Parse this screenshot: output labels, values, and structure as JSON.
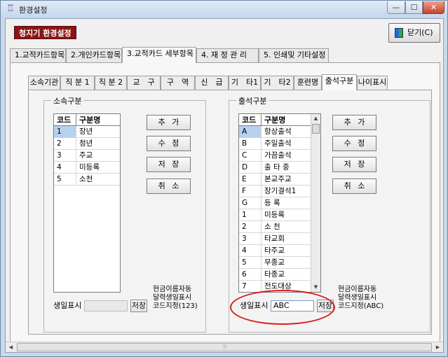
{
  "window": {
    "title": "환경설정",
    "minimize": "—",
    "maximize": "☐",
    "close": "✕",
    "app_icon": "chair-icon"
  },
  "header": {
    "label": "청지기 환경설정",
    "close_button": "닫기(C)"
  },
  "main_tabs": [
    {
      "label": "1.교적카드항목"
    },
    {
      "label": "2.개인카드항목"
    },
    {
      "label": "3.교적카드 세부항목",
      "active": true
    },
    {
      "label": "4. 재 정 관 리"
    },
    {
      "label": "5. 인쇄및 기타설정"
    }
  ],
  "sub_tabs": [
    {
      "label": "소속기관"
    },
    {
      "label": "직 분 1"
    },
    {
      "label": "직 분 2"
    },
    {
      "label": "교　구"
    },
    {
      "label": "구　역"
    },
    {
      "label": "신　급"
    },
    {
      "label": "기　타1"
    },
    {
      "label": "기　타2"
    },
    {
      "label": "훈련명"
    },
    {
      "label": "출석구분",
      "active": true
    },
    {
      "label": "나이표시"
    }
  ],
  "left_group": {
    "title": "소속구분",
    "columns": [
      "코드",
      "구분명"
    ],
    "rows": [
      {
        "code": "1",
        "name": "장년"
      },
      {
        "code": "2",
        "name": "청년"
      },
      {
        "code": "3",
        "name": "주교"
      },
      {
        "code": "4",
        "name": "미등록"
      },
      {
        "code": "5",
        "name": "소천"
      }
    ],
    "buttons": {
      "add": "추 가",
      "edit": "수 정",
      "save": "저 장",
      "cancel": "취 소"
    },
    "note": [
      "현금이름자동",
      "달력생일표시",
      "코드지정(123)"
    ],
    "birthday_label": "생일표시",
    "birthday_value": "",
    "save_small": "저장"
  },
  "right_group": {
    "title": "출석구분",
    "columns": [
      "코드",
      "구분명"
    ],
    "rows": [
      {
        "code": "A",
        "name": "항상출석"
      },
      {
        "code": "B",
        "name": "주일출석"
      },
      {
        "code": "C",
        "name": "가끔출석"
      },
      {
        "code": "D",
        "name": "출 타 중"
      },
      {
        "code": "E",
        "name": "본교주교"
      },
      {
        "code": "F",
        "name": "장기결석1"
      },
      {
        "code": "G",
        "name": "등 록"
      },
      {
        "code": "1",
        "name": "미등록"
      },
      {
        "code": "2",
        "name": "소 천"
      },
      {
        "code": "3",
        "name": "타교회"
      },
      {
        "code": "4",
        "name": "타주교"
      },
      {
        "code": "5",
        "name": "무종교"
      },
      {
        "code": "6",
        "name": "타종교"
      },
      {
        "code": "7",
        "name": "전도대상"
      }
    ],
    "buttons": {
      "add": "추 가",
      "edit": "수 정",
      "save": "저 장",
      "cancel": "취 소"
    },
    "note": [
      "현금이름자동",
      "달력생일표시",
      "코드지정(ABC)"
    ],
    "birthday_label": "생일표시",
    "birthday_value": "ABC",
    "save_small": "저장"
  },
  "colors": {
    "header_bg": "#8b1414",
    "selected_cell": "#b6d2ee",
    "highlight_ellipse": "#d81e1e"
  }
}
